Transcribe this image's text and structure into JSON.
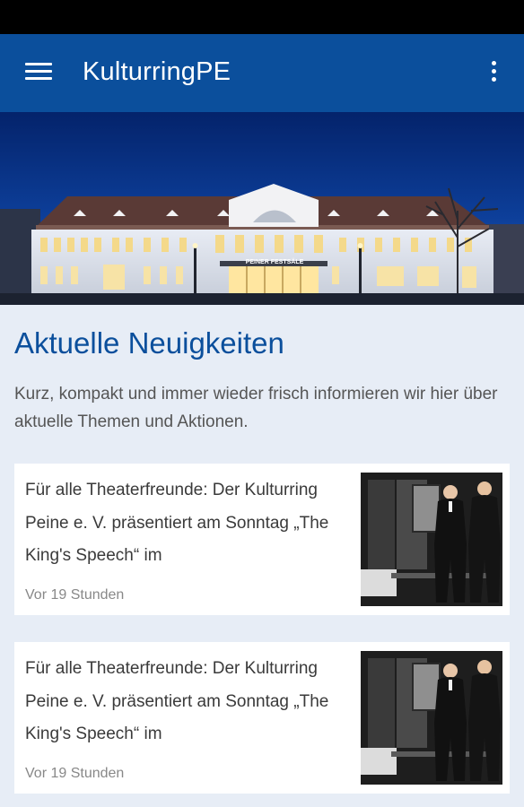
{
  "app": {
    "title": "KulturringPE"
  },
  "hero": {
    "sign_text": "PEINER FESTSÄLE"
  },
  "section": {
    "title": "Aktuelle Neuigkeiten",
    "intro": "Kurz, kompakt und immer wieder frisch informieren wir hier über aktuelle Themen und Aktionen."
  },
  "news": [
    {
      "text": "Für alle Theaterfreunde: Der Kulturring Peine e. V. präsentiert am Sonntag „The King's Speech“ im",
      "time": "Vor 19 Stunden"
    },
    {
      "text": "Für alle Theaterfreunde: Der Kulturring Peine e. V. präsentiert am Sonntag „The King's Speech“ im",
      "time": "Vor 19 Stunden"
    }
  ],
  "icons": {
    "menu": "hamburger-menu-icon",
    "overflow": "more-vert-icon"
  },
  "colors": {
    "appbar": "#0b4f9c",
    "background": "#e7edf6",
    "title": "#0b4f9c"
  }
}
